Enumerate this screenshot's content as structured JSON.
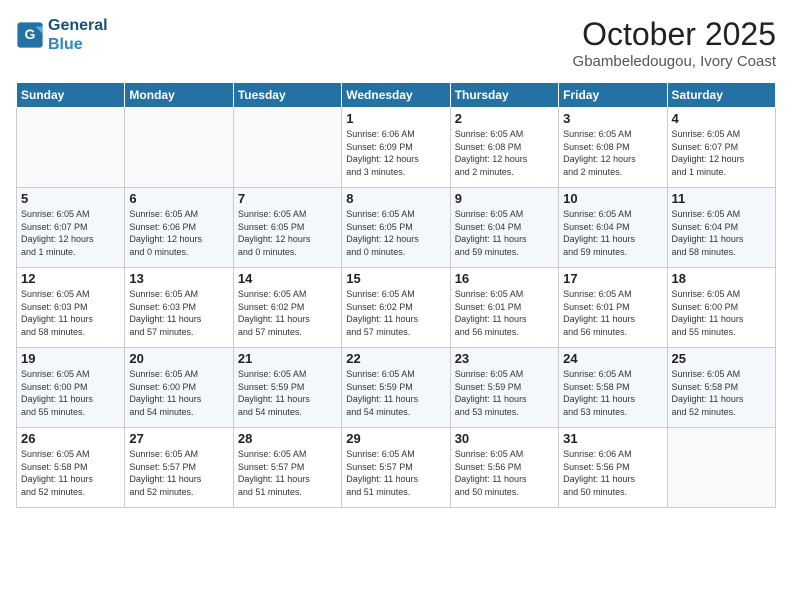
{
  "header": {
    "logo_line1": "General",
    "logo_line2": "Blue",
    "month": "October 2025",
    "location": "Gbambeledougou, Ivory Coast"
  },
  "weekdays": [
    "Sunday",
    "Monday",
    "Tuesday",
    "Wednesday",
    "Thursday",
    "Friday",
    "Saturday"
  ],
  "weeks": [
    [
      {
        "day": "",
        "info": ""
      },
      {
        "day": "",
        "info": ""
      },
      {
        "day": "",
        "info": ""
      },
      {
        "day": "1",
        "info": "Sunrise: 6:06 AM\nSunset: 6:09 PM\nDaylight: 12 hours\nand 3 minutes."
      },
      {
        "day": "2",
        "info": "Sunrise: 6:05 AM\nSunset: 6:08 PM\nDaylight: 12 hours\nand 2 minutes."
      },
      {
        "day": "3",
        "info": "Sunrise: 6:05 AM\nSunset: 6:08 PM\nDaylight: 12 hours\nand 2 minutes."
      },
      {
        "day": "4",
        "info": "Sunrise: 6:05 AM\nSunset: 6:07 PM\nDaylight: 12 hours\nand 1 minute."
      }
    ],
    [
      {
        "day": "5",
        "info": "Sunrise: 6:05 AM\nSunset: 6:07 PM\nDaylight: 12 hours\nand 1 minute."
      },
      {
        "day": "6",
        "info": "Sunrise: 6:05 AM\nSunset: 6:06 PM\nDaylight: 12 hours\nand 0 minutes."
      },
      {
        "day": "7",
        "info": "Sunrise: 6:05 AM\nSunset: 6:05 PM\nDaylight: 12 hours\nand 0 minutes."
      },
      {
        "day": "8",
        "info": "Sunrise: 6:05 AM\nSunset: 6:05 PM\nDaylight: 12 hours\nand 0 minutes."
      },
      {
        "day": "9",
        "info": "Sunrise: 6:05 AM\nSunset: 6:04 PM\nDaylight: 11 hours\nand 59 minutes."
      },
      {
        "day": "10",
        "info": "Sunrise: 6:05 AM\nSunset: 6:04 PM\nDaylight: 11 hours\nand 59 minutes."
      },
      {
        "day": "11",
        "info": "Sunrise: 6:05 AM\nSunset: 6:04 PM\nDaylight: 11 hours\nand 58 minutes."
      }
    ],
    [
      {
        "day": "12",
        "info": "Sunrise: 6:05 AM\nSunset: 6:03 PM\nDaylight: 11 hours\nand 58 minutes."
      },
      {
        "day": "13",
        "info": "Sunrise: 6:05 AM\nSunset: 6:03 PM\nDaylight: 11 hours\nand 57 minutes."
      },
      {
        "day": "14",
        "info": "Sunrise: 6:05 AM\nSunset: 6:02 PM\nDaylight: 11 hours\nand 57 minutes."
      },
      {
        "day": "15",
        "info": "Sunrise: 6:05 AM\nSunset: 6:02 PM\nDaylight: 11 hours\nand 57 minutes."
      },
      {
        "day": "16",
        "info": "Sunrise: 6:05 AM\nSunset: 6:01 PM\nDaylight: 11 hours\nand 56 minutes."
      },
      {
        "day": "17",
        "info": "Sunrise: 6:05 AM\nSunset: 6:01 PM\nDaylight: 11 hours\nand 56 minutes."
      },
      {
        "day": "18",
        "info": "Sunrise: 6:05 AM\nSunset: 6:00 PM\nDaylight: 11 hours\nand 55 minutes."
      }
    ],
    [
      {
        "day": "19",
        "info": "Sunrise: 6:05 AM\nSunset: 6:00 PM\nDaylight: 11 hours\nand 55 minutes."
      },
      {
        "day": "20",
        "info": "Sunrise: 6:05 AM\nSunset: 6:00 PM\nDaylight: 11 hours\nand 54 minutes."
      },
      {
        "day": "21",
        "info": "Sunrise: 6:05 AM\nSunset: 5:59 PM\nDaylight: 11 hours\nand 54 minutes."
      },
      {
        "day": "22",
        "info": "Sunrise: 6:05 AM\nSunset: 5:59 PM\nDaylight: 11 hours\nand 54 minutes."
      },
      {
        "day": "23",
        "info": "Sunrise: 6:05 AM\nSunset: 5:59 PM\nDaylight: 11 hours\nand 53 minutes."
      },
      {
        "day": "24",
        "info": "Sunrise: 6:05 AM\nSunset: 5:58 PM\nDaylight: 11 hours\nand 53 minutes."
      },
      {
        "day": "25",
        "info": "Sunrise: 6:05 AM\nSunset: 5:58 PM\nDaylight: 11 hours\nand 52 minutes."
      }
    ],
    [
      {
        "day": "26",
        "info": "Sunrise: 6:05 AM\nSunset: 5:58 PM\nDaylight: 11 hours\nand 52 minutes."
      },
      {
        "day": "27",
        "info": "Sunrise: 6:05 AM\nSunset: 5:57 PM\nDaylight: 11 hours\nand 52 minutes."
      },
      {
        "day": "28",
        "info": "Sunrise: 6:05 AM\nSunset: 5:57 PM\nDaylight: 11 hours\nand 51 minutes."
      },
      {
        "day": "29",
        "info": "Sunrise: 6:05 AM\nSunset: 5:57 PM\nDaylight: 11 hours\nand 51 minutes."
      },
      {
        "day": "30",
        "info": "Sunrise: 6:05 AM\nSunset: 5:56 PM\nDaylight: 11 hours\nand 50 minutes."
      },
      {
        "day": "31",
        "info": "Sunrise: 6:06 AM\nSunset: 5:56 PM\nDaylight: 11 hours\nand 50 minutes."
      },
      {
        "day": "",
        "info": ""
      }
    ]
  ]
}
